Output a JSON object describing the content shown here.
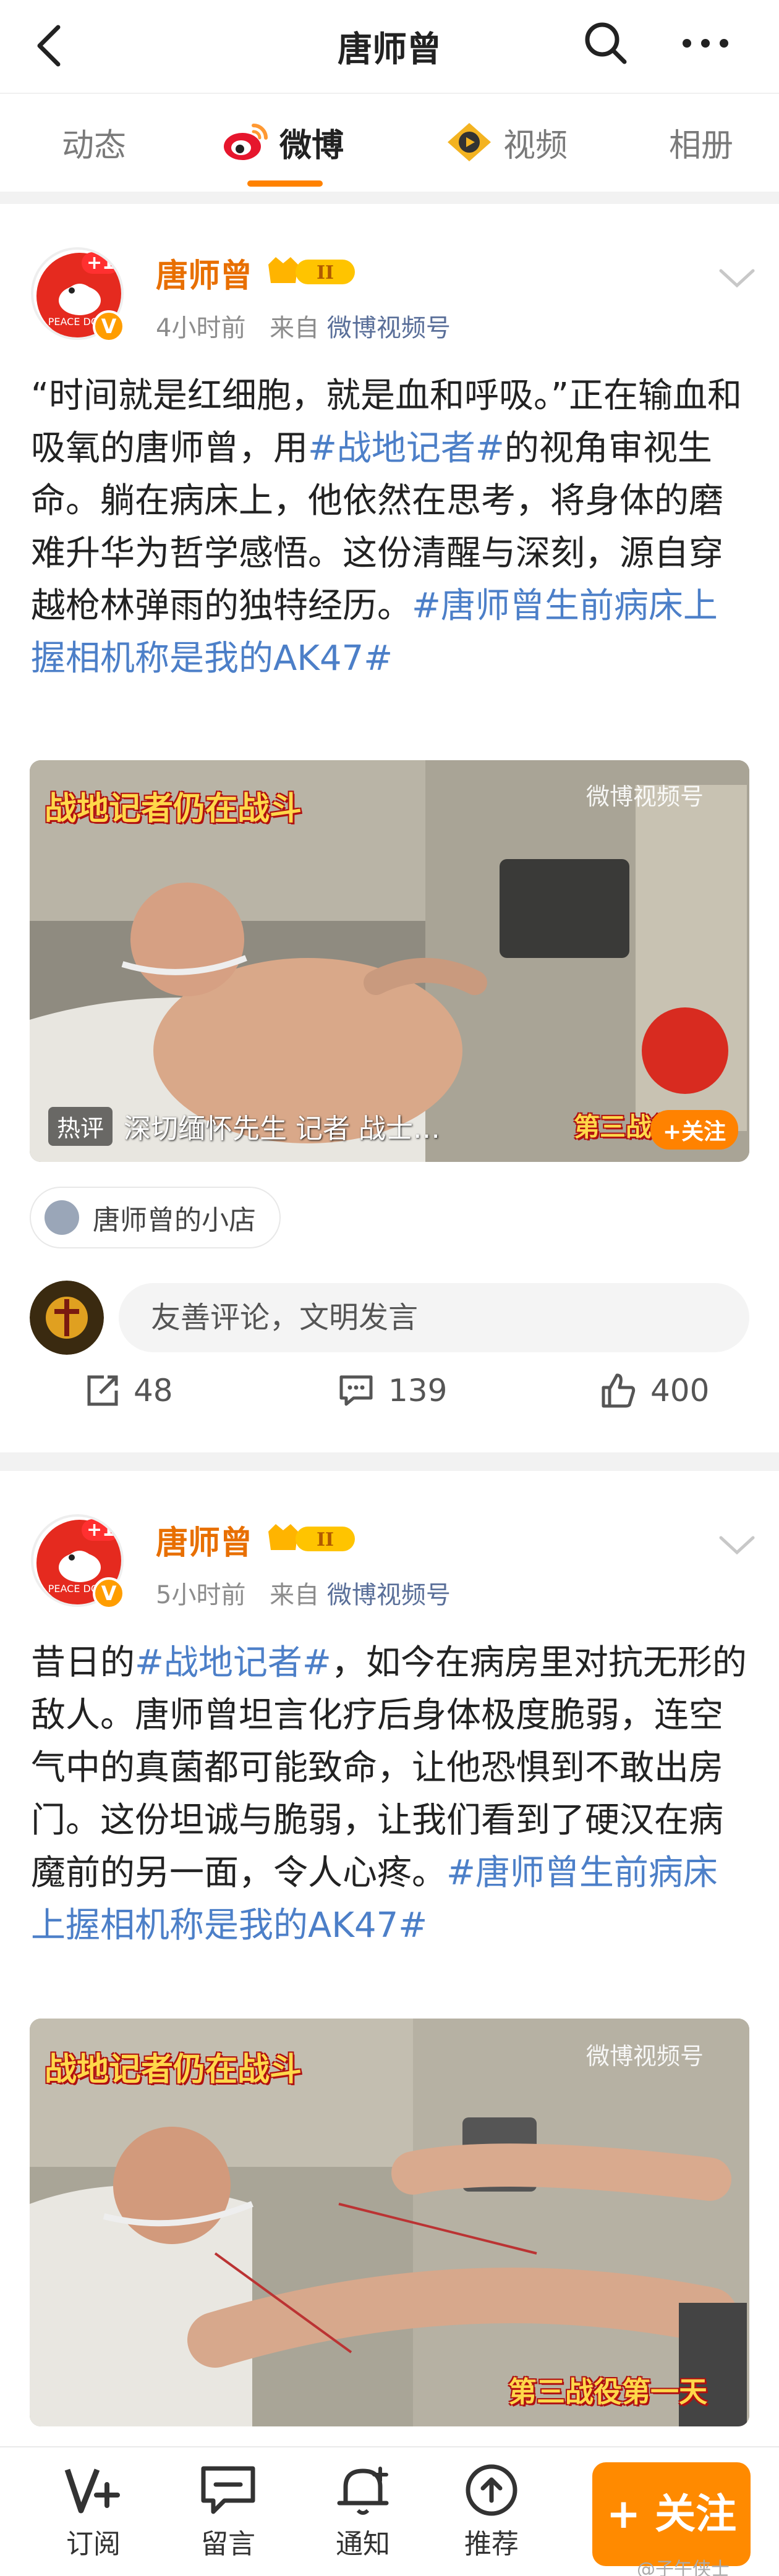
{
  "header": {
    "title": "唐师曾"
  },
  "tabs": [
    {
      "label": "动态"
    },
    {
      "label": "微博"
    },
    {
      "label": "视频"
    },
    {
      "label": "相册"
    }
  ],
  "posts": [
    {
      "author": "唐师曾",
      "badge_level": "II",
      "avatar_notice": "+1",
      "avatar_text": "PEACE DOVE",
      "time": "4小时前",
      "source_prefix": "来自",
      "source": "微博视频号",
      "text_segments": [
        {
          "t": "“时间就是红细胞，就是血和呼吸。”正在输血和吸氧的唐师曾，用",
          "topic": false
        },
        {
          "t": "#战地记者#",
          "topic": true
        },
        {
          "t": "的视角审视生命。躺在病床上，他依然在思考，将身体的磨难升华为哲学感悟。这份清醒与深刻，源自穿越枪林弹雨的独特经历。",
          "topic": false
        },
        {
          "t": "#唐师曾生前病床上握相机称是我的AK47#",
          "topic": true
        }
      ],
      "media": {
        "banner": "战地记者仍在战斗",
        "watermark": "微博视频号",
        "hot_tag": "热评",
        "hot_text": "深切缅怀先生  记者  战士…",
        "overlay_tag": "第三战役",
        "follow_pill": "+关注"
      },
      "shop_label": "唐师曾的小店",
      "comment_placeholder": "友善评论，文明发言",
      "reposts": "48",
      "comments": "139",
      "likes": "400"
    },
    {
      "author": "唐师曾",
      "badge_level": "II",
      "avatar_notice": "+1",
      "avatar_text": "PEACE DOVE",
      "time": "5小时前",
      "source_prefix": "来自",
      "source": "微博视频号",
      "text_segments": [
        {
          "t": "昔日的",
          "topic": false
        },
        {
          "t": "#战地记者#",
          "topic": true
        },
        {
          "t": "，如今在病房里对抗无形的敌人。唐师曾坦言化疗后身体极度脆弱，连空气中的真菌都可能致命，让他恐惧到不敢出房门。这份坦诚与脆弱，让我们看到了硬汉在病魔前的另一面，令人心疼。",
          "topic": false
        },
        {
          "t": "#唐师曾生前病床上握相机称是我的AK47#",
          "topic": true
        }
      ],
      "media": {
        "banner": "战地记者仍在战斗",
        "watermark": "微博视频号",
        "overlay_tag": "第三战役第一天"
      }
    }
  ],
  "bottom_bar": {
    "items": [
      {
        "label": "订阅"
      },
      {
        "label": "留言"
      },
      {
        "label": "通知"
      },
      {
        "label": "推荐"
      }
    ],
    "follow_label": "+ 关注",
    "credit": "@子午侠士"
  },
  "colors": {
    "accent": "#ff8200",
    "topic": "#4c7fc8",
    "author": "#e86f00"
  }
}
